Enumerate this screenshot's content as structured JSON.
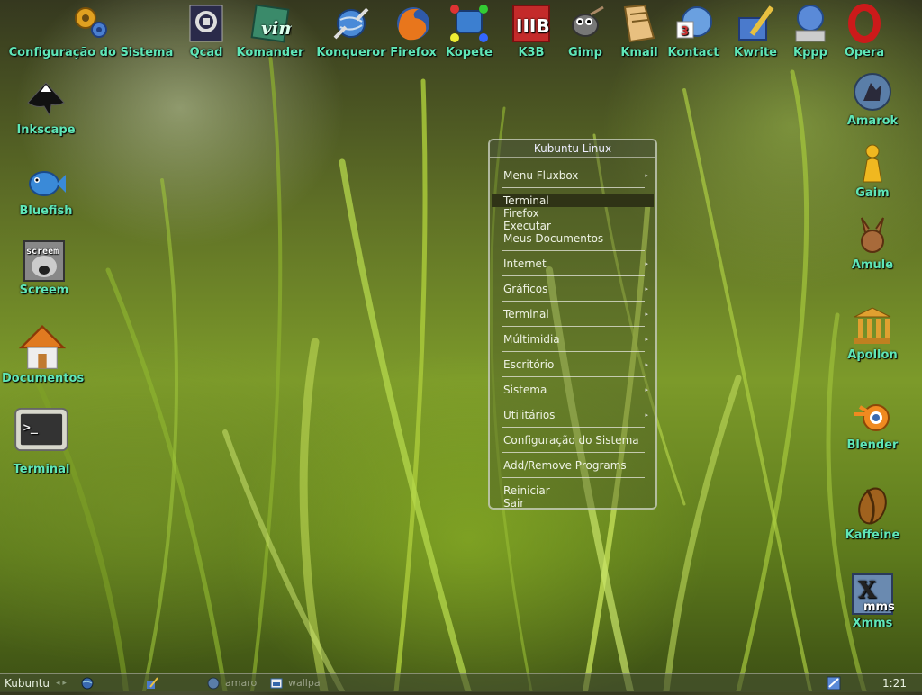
{
  "desktop_icons_top": [
    {
      "name": "configuracao-icon",
      "label": "Configuração do Sistema"
    },
    {
      "name": "qcad-icon",
      "label": "Qcad"
    },
    {
      "name": "komander-icon",
      "label": "Komander"
    },
    {
      "name": "konqueror-icon",
      "label": "Konqueror"
    },
    {
      "name": "firefox-icon",
      "label": "Firefox"
    },
    {
      "name": "kopete-icon",
      "label": "Kopete"
    },
    {
      "name": "k3b-icon",
      "label": "K3B"
    },
    {
      "name": "gimp-icon",
      "label": "Gimp"
    },
    {
      "name": "kmail-icon",
      "label": "Kmail"
    },
    {
      "name": "kontact-icon",
      "label": "Kontact"
    },
    {
      "name": "kwrite-icon",
      "label": "Kwrite"
    },
    {
      "name": "kppp-icon",
      "label": "Kppp"
    },
    {
      "name": "opera-icon",
      "label": "Opera"
    }
  ],
  "desktop_icons_left": [
    {
      "name": "inkscape-icon",
      "label": "Inkscape"
    },
    {
      "name": "bluefish-icon",
      "label": "Bluefish"
    },
    {
      "name": "screem-icon",
      "label": "Screem",
      "glyph_text": "screem"
    },
    {
      "name": "documentos-icon",
      "label": "Documentos"
    },
    {
      "name": "terminal-icon",
      "label": "Terminal",
      "glyph_text": ">_"
    }
  ],
  "desktop_icons_right": [
    {
      "name": "amarok-icon",
      "label": "Amarok"
    },
    {
      "name": "gaim-icon",
      "label": "Gaim"
    },
    {
      "name": "amule-icon",
      "label": "Amule"
    },
    {
      "name": "apollon-icon",
      "label": "Apollon"
    },
    {
      "name": "blender-icon",
      "label": "Blender"
    },
    {
      "name": "kaffeine-icon",
      "label": "Kaffeine"
    },
    {
      "name": "xmms-icon",
      "label": "Xmms",
      "glyph_text": "X",
      "glyph_sub": "mms"
    }
  ],
  "menu": {
    "title": "Kubuntu Linux",
    "items": [
      {
        "label": "Menu Fluxbox",
        "submenu": true
      },
      {
        "label": "Terminal",
        "submenu": false,
        "highlighted": true
      },
      {
        "label": "Firefox",
        "submenu": false
      },
      {
        "label": "Executar",
        "submenu": false
      },
      {
        "label": "Meus Documentos",
        "submenu": false
      },
      {
        "label": "Internet",
        "submenu": true
      },
      {
        "label": "Gráficos",
        "submenu": true
      },
      {
        "label": "Terminal",
        "submenu": true
      },
      {
        "label": "Múltimidia",
        "submenu": true
      },
      {
        "label": "Escritório",
        "submenu": true
      },
      {
        "label": "Sistema",
        "submenu": true
      },
      {
        "label": "Utilitários",
        "submenu": true
      },
      {
        "label": "Configuração do Sistema",
        "submenu": false
      },
      {
        "label": "Add/Remove Programs",
        "submenu": false
      },
      {
        "label": "Reiniciar",
        "submenu": false
      },
      {
        "label": "Sair",
        "submenu": false
      }
    ]
  },
  "taskbar": {
    "workspace_label": "Kubuntu",
    "workspace_arrows": "◂ ▸",
    "tasks": [
      "amaro",
      "wallpa"
    ],
    "clock": "1:21"
  },
  "colors": {
    "icon_label": "#5fe6b7",
    "menu_highlight": "#2f3316"
  }
}
